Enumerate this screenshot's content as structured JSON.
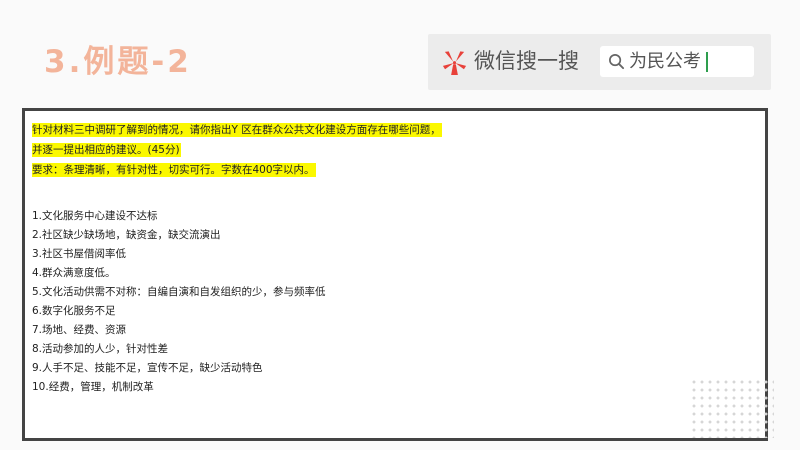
{
  "slide": {
    "title": "3.例题-2"
  },
  "search_banner": {
    "brand_name": "微信搜一搜",
    "search_query": "为民公考",
    "brand_color": "#e8413a",
    "caret_color": "#2e9e4e"
  },
  "question": {
    "lines": [
      "针对材料三中调研了解到的情况，请你指出Y 区在群众公共文化建设方面存在哪些问题，",
      "并逐一提出相应的建议。(45分)",
      "要求：条理清晰，有针对性，切实可行。字数在400字以内。"
    ],
    "highlight_color": "#fbf800"
  },
  "answers": [
    "1.文化服务中心建设不达标",
    "2.社区缺少缺场地，缺资金，缺交流演出",
    "3.社区书屋借阅率低",
    "4.群众满意度低。",
    "5.文化活动供需不对称：自编自演和自发组织的少，参与频率低",
    "6.数字化服务不足",
    "7.场地、经费、资源",
    "8.活动参加的人少，针对性差",
    "9.人手不足、技能不足，宣传不足，缺少活动特色",
    "10.经费，管理，机制改革"
  ],
  "icons": {
    "brand": "wechat-search-flower-icon",
    "search": "magnifier-icon",
    "decoration": "dot-grid"
  }
}
